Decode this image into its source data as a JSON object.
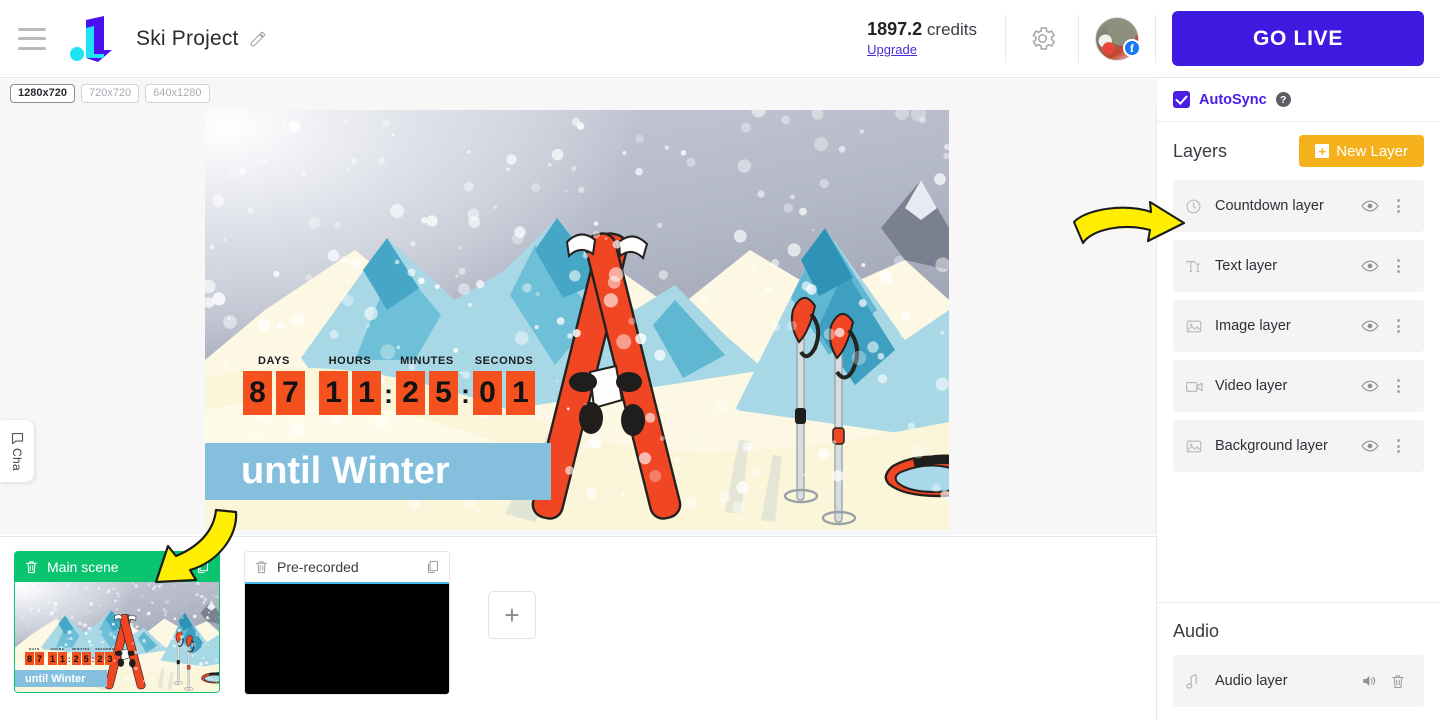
{
  "header": {
    "menu_icon": "hamburger-menu-icon",
    "logo_icon": "app-logo-icon",
    "project_title": "Ski Project",
    "edit_icon": "pencil-icon",
    "credits_value": "1897.2",
    "credits_word": "credits",
    "upgrade_label": "Upgrade",
    "settings_icon": "gear-icon",
    "avatar_icon": "user-avatar",
    "avatar_badge": "f",
    "go_live_label": "GO LIVE",
    "go_live_color": "#3f1ae0"
  },
  "resolutions": [
    {
      "label": "1280x720",
      "selected": true
    },
    {
      "label": "720x720",
      "selected": false
    },
    {
      "label": "640x1280",
      "selected": false
    }
  ],
  "canvas": {
    "collapse_icon": "chevron-down-icon",
    "countdown": {
      "labels": [
        "DAYS",
        "HOURS",
        "MINUTES",
        "SECONDS"
      ],
      "days": [
        "8",
        "7"
      ],
      "hours": [
        "1",
        "1"
      ],
      "minutes": [
        "2",
        "5"
      ],
      "seconds": [
        "0",
        "1"
      ],
      "separator": ":",
      "digit_bg": "#f4511e",
      "caption": "until Winter",
      "caption_bg": "#84c0de"
    }
  },
  "chat_tab": {
    "icon": "chat-bubble-icon",
    "label": "Cha"
  },
  "scenes": {
    "items": [
      {
        "title": "Main scene",
        "active": true,
        "delete_icon": "trash-icon",
        "copy_icon": "duplicate-icon"
      },
      {
        "title": "Pre-recorded",
        "active": false,
        "delete_icon": "trash-icon",
        "copy_icon": "duplicate-icon"
      }
    ],
    "add_label": "+",
    "thumb_countdown": {
      "labels": [
        "DAYS",
        "HOURS",
        "MINUTES",
        "SECONDS"
      ],
      "days": [
        "8",
        "7"
      ],
      "hours": [
        "1",
        "1"
      ],
      "minutes": [
        "2",
        "5"
      ],
      "seconds": [
        "2",
        "3"
      ],
      "separator": ":",
      "caption": "until Winter"
    }
  },
  "right_panel": {
    "autosync_label": "AutoSync",
    "autosync_checked": true,
    "autosync_color": "#4b1fe3",
    "help_icon": "question-mark-icon",
    "layers_title": "Layers",
    "new_layer_label": "New Layer",
    "new_layer_color": "#f5b11c",
    "layers": [
      {
        "name": "Countdown layer",
        "icon": "clock-icon",
        "visible_icon": "eye-icon",
        "menu_icon": "kebab-menu-icon"
      },
      {
        "name": "Text layer",
        "icon": "text-icon",
        "visible_icon": "eye-icon",
        "menu_icon": "kebab-menu-icon"
      },
      {
        "name": "Image layer",
        "icon": "image-icon",
        "visible_icon": "eye-icon",
        "menu_icon": "kebab-menu-icon"
      },
      {
        "name": "Video layer",
        "icon": "video-camera-icon",
        "visible_icon": "eye-icon",
        "menu_icon": "kebab-menu-icon"
      },
      {
        "name": "Background layer",
        "icon": "image-icon",
        "visible_icon": "eye-icon",
        "menu_icon": "kebab-menu-icon"
      }
    ],
    "audio_title": "Audio",
    "audio_layers": [
      {
        "name": "Audio layer",
        "icon": "music-note-icon",
        "volume_icon": "speaker-icon",
        "delete_icon": "trash-icon"
      }
    ]
  },
  "annotations": [
    {
      "name": "arrow-to-countdown-layer",
      "color": "#ffee00"
    },
    {
      "name": "arrow-to-main-scene",
      "color": "#ffee00"
    }
  ]
}
